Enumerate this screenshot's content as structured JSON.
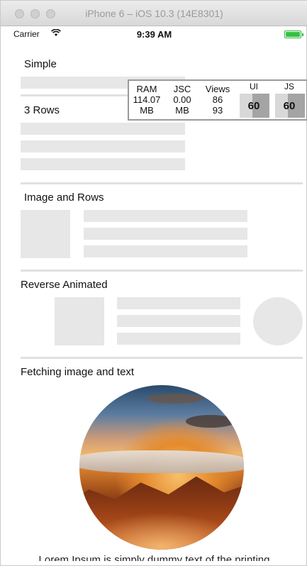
{
  "window": {
    "title": "iPhone 6 – iOS 10.3 (14E8301)"
  },
  "status_bar": {
    "carrier": "Carrier",
    "wifi_icon": "wifi-icon",
    "time": "9:39 AM",
    "battery_icon": "battery-icon",
    "battery_color": "#33c244"
  },
  "sections": {
    "simple": {
      "title": "Simple"
    },
    "three_rows": {
      "title": "3 Rows"
    },
    "image_and_rows": {
      "title": "Image and Rows"
    },
    "reverse_animated": {
      "title": "Reverse Animated"
    },
    "fetching": {
      "title": "Fetching image and text",
      "text": "Lorem Ipsum is simply dummy text of the printing"
    }
  },
  "perf_monitor": {
    "ram": {
      "label": "RAM",
      "value": "114.07",
      "unit": "MB"
    },
    "jsc": {
      "label": "JSC",
      "value": "0.00",
      "unit": "MB"
    },
    "views": {
      "label": "Views",
      "value_top": "86",
      "value_bottom": "93"
    },
    "ui_fps": {
      "label": "UI",
      "value": "60"
    },
    "js_fps": {
      "label": "JS",
      "value": "60"
    }
  },
  "colors": {
    "placeholder": "#e7e7e7",
    "divider": "#e1e1e1"
  }
}
